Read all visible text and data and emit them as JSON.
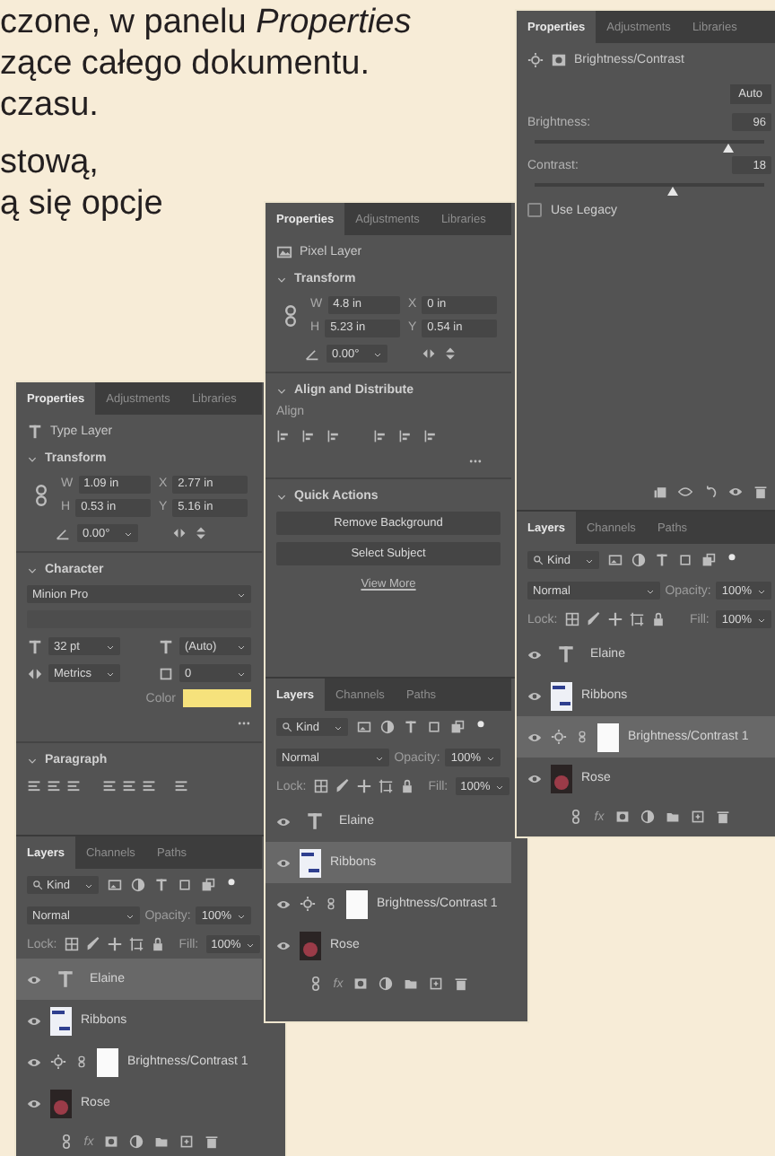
{
  "body_text": [
    "czone, w panelu *Properties*",
    "zące całego dokumentu.",
    "czasu.",
    "stową,",
    "ą się opcje"
  ],
  "panels": [
    {
      "properties": {
        "tabs": [
          {
            "label": "Properties",
            "selected": true
          },
          {
            "label": "Adjustments",
            "selected": false
          },
          {
            "label": "Libraries",
            "selected": false
          }
        ],
        "layer_type": {
          "kind": "type",
          "label": "Type Layer"
        },
        "sections": [
          {
            "kind": "transform",
            "title": "Transform",
            "fields": [
              {
                "label": "W",
                "value": "1.09 in"
              },
              {
                "label": "X",
                "value": "2.77 in"
              },
              {
                "label": "H",
                "value": "0.53 in"
              },
              {
                "label": "Y",
                "value": "5.16 in"
              }
            ],
            "angle": "0.00°"
          },
          {
            "kind": "character",
            "title": "Character",
            "font": "Minion Pro",
            "size": "32 pt",
            "leading": "(Auto)",
            "kerning": "Metrics",
            "tracking": "0",
            "color_label": "Color",
            "color": "#f6e27c"
          },
          {
            "kind": "paragraph",
            "title": "Paragraph"
          }
        ]
      },
      "layers": {
        "tabs": [
          {
            "label": "Layers",
            "selected": true
          },
          {
            "label": "Channels",
            "selected": false
          },
          {
            "label": "Paths",
            "selected": false
          }
        ],
        "filter": "Kind",
        "blend": "Normal",
        "opacity_label": "Opacity:",
        "opacity": "100%",
        "lock_label": "Lock:",
        "fill_label": "Fill:",
        "fill": "100%",
        "fx_label": "fx",
        "items": [
          {
            "kind": "text",
            "name": "Elaine",
            "visible": true,
            "selected": true
          },
          {
            "kind": "image",
            "name": "Ribbons",
            "visible": true,
            "selected": false
          },
          {
            "kind": "adjustment",
            "name": "Brightness/Contrast 1",
            "visible": true,
            "selected": false
          },
          {
            "kind": "photo",
            "name": "Rose",
            "visible": true,
            "selected": false
          }
        ]
      }
    },
    {
      "properties": {
        "tabs": [
          {
            "label": "Properties",
            "selected": true
          },
          {
            "label": "Adjustments",
            "selected": false
          },
          {
            "label": "Libraries",
            "selected": false
          }
        ],
        "layer_type": {
          "kind": "pixel",
          "label": "Pixel Layer"
        },
        "sections": [
          {
            "kind": "transform",
            "title": "Transform",
            "fields": [
              {
                "label": "W",
                "value": "4.8 in"
              },
              {
                "label": "X",
                "value": "0 in"
              },
              {
                "label": "H",
                "value": "5.23 in"
              },
              {
                "label": "Y",
                "value": "0.54 in"
              }
            ],
            "angle": "0.00°"
          },
          {
            "kind": "align",
            "title": "Align and Distribute",
            "subtitle": "Align"
          },
          {
            "kind": "quick_actions",
            "title": "Quick Actions",
            "buttons": [
              "Remove Background",
              "Select Subject"
            ],
            "link": "View More"
          }
        ]
      },
      "layers": {
        "tabs": [
          {
            "label": "Layers",
            "selected": true
          },
          {
            "label": "Channels",
            "selected": false
          },
          {
            "label": "Paths",
            "selected": false
          }
        ],
        "filter": "Kind",
        "blend": "Normal",
        "opacity_label": "Opacity:",
        "opacity": "100%",
        "lock_label": "Lock:",
        "fill_label": "Fill:",
        "fill": "100%",
        "fx_label": "fx",
        "items": [
          {
            "kind": "text",
            "name": "Elaine",
            "visible": true,
            "selected": false
          },
          {
            "kind": "image",
            "name": "Ribbons",
            "visible": true,
            "selected": true
          },
          {
            "kind": "adjustment",
            "name": "Brightness/Contrast 1",
            "visible": true,
            "selected": false
          },
          {
            "kind": "photo",
            "name": "Rose",
            "visible": true,
            "selected": false
          }
        ]
      }
    },
    {
      "properties": {
        "tabs": [
          {
            "label": "Properties",
            "selected": true
          },
          {
            "label": "Adjustments",
            "selected": false
          },
          {
            "label": "Libraries",
            "selected": false
          }
        ],
        "layer_type": {
          "kind": "adjustment",
          "label": "Brightness/Contrast"
        },
        "sections": [
          {
            "kind": "adjustment",
            "auto": "Auto",
            "sliders": [
              {
                "label": "Brightness:",
                "value": "96",
                "level": 0.84
              },
              {
                "label": "Contrast:",
                "value": "18",
                "level": 0.6
              }
            ],
            "checkbox": {
              "label": "Use Legacy",
              "checked": false
            }
          }
        ]
      },
      "layers": {
        "tabs": [
          {
            "label": "Layers",
            "selected": true
          },
          {
            "label": "Channels",
            "selected": false
          },
          {
            "label": "Paths",
            "selected": false
          }
        ],
        "filter": "Kind",
        "blend": "Normal",
        "opacity_label": "Opacity:",
        "opacity": "100%",
        "lock_label": "Lock:",
        "fill_label": "Fill:",
        "fill": "100%",
        "fx_label": "fx",
        "items": [
          {
            "kind": "text",
            "name": "Elaine",
            "visible": true,
            "selected": false
          },
          {
            "kind": "image",
            "name": "Ribbons",
            "visible": true,
            "selected": false
          },
          {
            "kind": "adjustment",
            "name": "Brightness/Contrast 1",
            "visible": true,
            "selected": true
          },
          {
            "kind": "photo",
            "name": "Rose",
            "visible": true,
            "selected": false
          }
        ]
      }
    }
  ]
}
